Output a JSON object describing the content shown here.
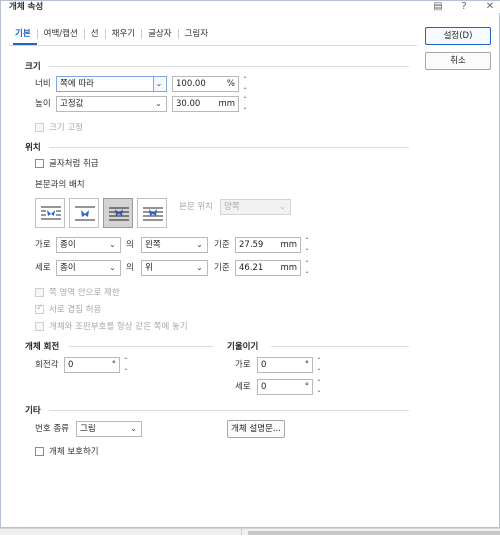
{
  "window": {
    "title": "개체 속성",
    "icons": [
      "comment-icon",
      "help-icon",
      "close-icon"
    ]
  },
  "tabs": [
    "기본",
    "여백/캡션",
    "선",
    "채우기",
    "글상자",
    "그림자"
  ],
  "buttons": {
    "ok": "설정(D)",
    "cancel": "취소",
    "description": "개체 설명문..."
  },
  "size": {
    "title": "크기",
    "width_label": "너비",
    "width_mode": "쪽에 따라",
    "width_value": "100.00",
    "width_unit": "%",
    "height_label": "높이",
    "height_mode": "고정값",
    "height_value": "30.00",
    "height_unit": "mm",
    "lock_label": "크기 고정"
  },
  "position": {
    "title": "위치",
    "treat_as_char": "글자처럼 취급",
    "text_layout_label": "본문과의 배치",
    "text_position_label": "본문 위치",
    "text_position_value": "양쪽",
    "horiz_label": "가로",
    "horiz_ref": "종이",
    "horiz_of": "의",
    "horiz_align": "왼쪽",
    "horiz_basis": "기준",
    "horiz_value": "27.59",
    "horiz_unit": "mm",
    "vert_label": "세로",
    "vert_ref": "종이",
    "vert_of": "의",
    "vert_align": "위",
    "vert_basis": "기준",
    "vert_value": "46.21",
    "vert_unit": "mm",
    "opt_limit": "쪽 영역 안으로 제한",
    "opt_overlap": "서로 겹침 허용",
    "opt_same_page": "개체와 조판부호를 항상 같은 쪽에 놓기"
  },
  "rotation": {
    "title": "개체 회전",
    "angle_label": "회전각",
    "angle_value": "0",
    "angle_unit": "°"
  },
  "skew": {
    "title": "기울이기",
    "horiz_label": "가로",
    "horiz_value": "0",
    "horiz_unit": "°",
    "vert_label": "세로",
    "vert_value": "0",
    "vert_unit": "°"
  },
  "other": {
    "title": "기타",
    "number_type_label": "번호 종류",
    "number_type_value": "그림",
    "protect_label": "개체 보호하기"
  },
  "colors": {
    "accent": "#1f63c6",
    "wrap_icon": "#3366cc"
  }
}
